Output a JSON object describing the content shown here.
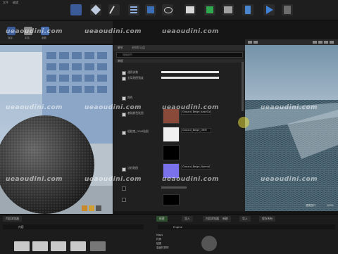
{
  "menubar": {
    "items": [
      "文件",
      "编辑"
    ]
  },
  "toolbar": {
    "buttons": [
      {
        "name": "save",
        "color": "#5a7ab8"
      },
      {
        "name": "browse",
        "color": "#8aa0c8"
      },
      {
        "name": "brush",
        "color": "#cfcfcf"
      },
      {
        "name": "settings",
        "color": "#6a8ac0"
      },
      {
        "name": "blueprint",
        "color": "#4a8ad0"
      },
      {
        "name": "marketplace",
        "color": "#cfcfcf"
      },
      {
        "name": "sequence",
        "color": "#3ab060"
      },
      {
        "name": "build",
        "color": "#cfcfcf"
      },
      {
        "name": "launch",
        "color": "#4a8ad0"
      },
      {
        "name": "play",
        "color": "#3a7ad0"
      },
      {
        "name": "launch-game",
        "color": "#cfcfcf"
      }
    ]
  },
  "left_tools": {
    "labels": [
      "保存",
      "浏览",
      "参数"
    ]
  },
  "details": {
    "header_tabs": [
      "细节",
      "参数默认值"
    ],
    "search_placeholder": "搜索细节",
    "section_general": "常规",
    "rows": [
      {
        "label": "通用参数",
        "value": ""
      },
      {
        "label": "全局贴图强度",
        "value": ""
      },
      {
        "label": "颜色",
        "value": ""
      },
      {
        "label": "基础颜色贴图",
        "value": "Ground_Beige_baseColor"
      },
      {
        "label": "粗糙度_ORM贴图",
        "value": "Ground_Beige_ORM"
      },
      {
        "label": "",
        "value": ""
      },
      {
        "label": "法线贴图",
        "value": "Ground_Beige_Normal"
      },
      {
        "label": "",
        "value": ""
      },
      {
        "label": "",
        "value": ""
      }
    ]
  },
  "viewport_right": {
    "label": "透视视口",
    "fps": "100%"
  },
  "bottom": {
    "tabs": [
      "内容浏览器",
      "新建",
      "导入",
      "保存所有"
    ],
    "tabs_right": [
      "内容浏览器",
      "新建",
      "导入"
    ],
    "path_left": "内容",
    "path_right": "Engine",
    "tree_items": [
      "Maps",
      "材质",
      "贴图",
      "高级材质球"
    ]
  },
  "watermark": "ueaoudini.com"
}
